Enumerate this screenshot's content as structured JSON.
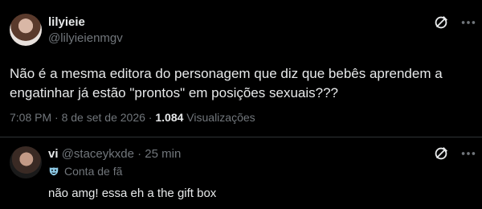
{
  "post": {
    "author_name": "lilyieie",
    "author_handle": "@lilyieienmgv",
    "text": "Não é a mesma editora do personagem que diz que bebês aprendem a engatinhar já estão \"prontos\" em posições sexuais???",
    "time": "7:08 PM",
    "separator": "·",
    "date": "8 de set de 2026",
    "views_count": "1.084",
    "views_label": "Visualizações",
    "more_icon": "slashed-circle-icon",
    "more_label": "More",
    "more_label_icon": "x-icon"
  },
  "reply": {
    "author_name": "vi",
    "author_handle": "@staceykxde",
    "separator": "·",
    "age": "25 min",
    "badge_icon": "mask-icon",
    "badge_label": "Conta de fã",
    "text": "não amg! essa eh a the gift box",
    "more_icon": "slashed-circle-icon"
  },
  "colors": {
    "background": "#000000",
    "text": "#e7e9ea",
    "muted": "#71767b",
    "divider": "#2f3336"
  }
}
